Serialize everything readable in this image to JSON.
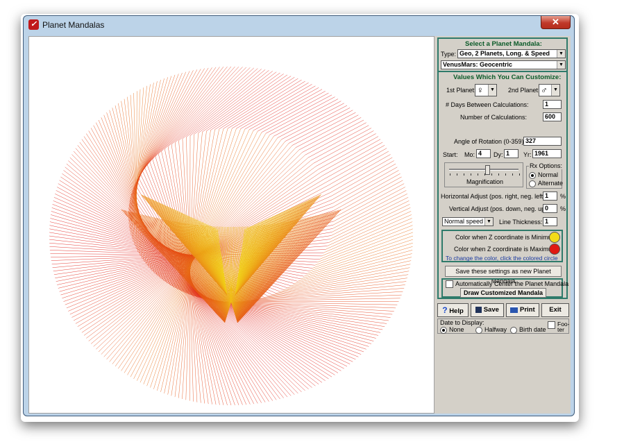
{
  "window": {
    "title": "Planet Mandalas",
    "close_label": "✕"
  },
  "panel": {
    "select_header": "Select a Planet Mandala:",
    "type_label": "Type:",
    "type_value": "Geo,  2 Planets, Long. & Speed",
    "mandala_value": "VenusMars: Geocentric",
    "values_header": "Values Which You Can Customize:",
    "planet1_label": "1st Planet:",
    "planet1_value": "♀",
    "planet2_label": "2nd Planet:",
    "planet2_value": "♂",
    "days_label": "# Days Between Calculations:",
    "days_value": "1",
    "calcs_label": "Number of Calculations:",
    "calcs_value": "600",
    "angle_label": "Angle of Rotation (0-359):",
    "angle_value": "327",
    "start_label": "Start:",
    "mo_label": "Mo:",
    "mo_value": "4",
    "dy_label": "Dy:",
    "dy_value": "1",
    "yr_label": "Yr:",
    "yr_value": "1961",
    "magnification_label": "Magnification",
    "magnification_level": 0.55,
    "rx_label": "Rx Options:",
    "rx_normal": "Normal",
    "rx_alternate": "Alternate",
    "hadjust_label": "Horizontal Adjust (pos. right,  neg. left)",
    "hadjust_value": "1",
    "vadjust_label": "Vertical Adjust (pos. down,  neg. up)",
    "vadjust_value": "0",
    "percent": "%",
    "speed_value": "Normal speed",
    "thickness_label": "Line Thickness:",
    "thickness_value": "1",
    "color_min_label": "Color when Z coordinate is Minimum:",
    "color_min": "#f2dc18",
    "color_max_label": "Color when Z coordinate is Maximum:",
    "color_max": "#e01812",
    "color_hint": "To change the color,  click the colored circle",
    "save_settings_label": "Save these settings as new Planet Mandala",
    "auto_center_label": "Automatically Center the Planet Mandala",
    "draw_label": "Draw Customized Mandala"
  },
  "buttons": {
    "help": "Help",
    "save": "Save",
    "print": "Print",
    "exit": "Exit"
  },
  "date_display": {
    "label": "Date to Display:",
    "none": "None",
    "halfway": "Halfway",
    "birth": "Birth date",
    "footer": "Foo-\nter"
  },
  "mandala": {
    "planet1": "Venus",
    "planet2": "Mars",
    "color_start": "#f2dc18",
    "color_end": "#e01812"
  }
}
